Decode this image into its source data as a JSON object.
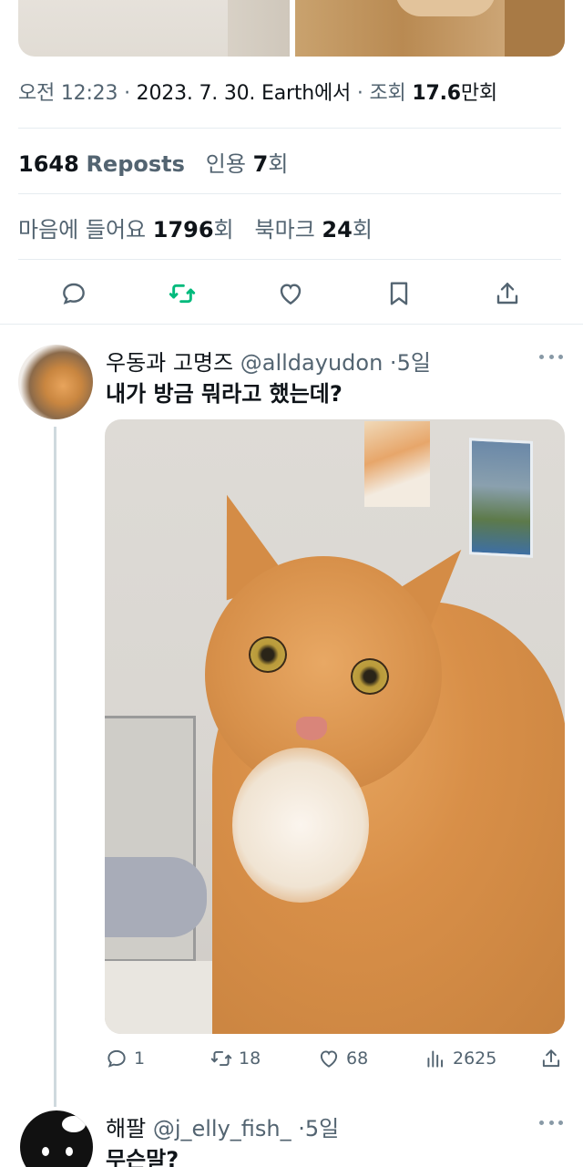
{
  "tweet_meta": {
    "time": "오전 12:23",
    "date": "2023. 7. 30.",
    "source": "Earth에서",
    "views_label": "조회",
    "views_value": "17.6",
    "views_unit": "만회"
  },
  "stats": {
    "reposts_count": "1648",
    "reposts_label": "Reposts",
    "quotes_label": "인용",
    "quotes_count": "7",
    "quotes_unit": "회",
    "likes_label": "마음에 들어요",
    "likes_count": "1796",
    "likes_unit": "회",
    "bookmarks_label": "북마크",
    "bookmarks_count": "24",
    "bookmarks_unit": "회"
  },
  "colors": {
    "accent_repost": "#00ba7c",
    "text_secondary": "#536471",
    "divider": "#e6ecf0"
  },
  "actions": [
    "reply-icon",
    "repost-icon",
    "like-icon",
    "bookmark-icon",
    "share-icon"
  ],
  "replies": [
    {
      "name": "우동과 고명즈",
      "handle": "@alldayudon",
      "time": "5일",
      "text": "내가 방금 뭐라고 했는데?",
      "reply_count": "1",
      "repost_count": "18",
      "like_count": "68",
      "view_count": "2625"
    },
    {
      "name": "해팔",
      "handle": "@j_elly_fish_",
      "time": "5일",
      "text": "무슨말?"
    }
  ]
}
